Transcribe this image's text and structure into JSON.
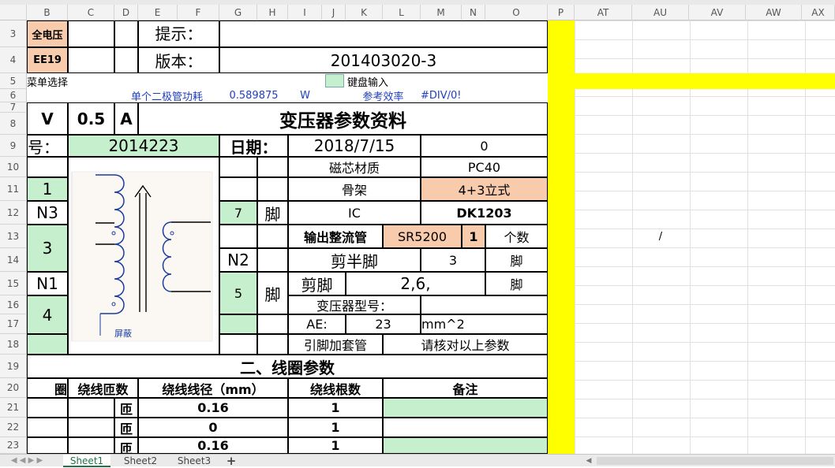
{
  "columns": [
    "B",
    "C",
    "D",
    "E",
    "F",
    "G",
    "H",
    "I",
    "J",
    "K",
    "L",
    "M",
    "N",
    "O",
    "P",
    "AT",
    "AU",
    "AV",
    "AW",
    "AX"
  ],
  "rows": [
    "3",
    "4",
    "5",
    "6",
    "7",
    "8",
    "9",
    "10",
    "11",
    "12",
    "13",
    "14",
    "15",
    "16",
    "17",
    "18",
    "19",
    "20",
    "21",
    "22",
    "23"
  ],
  "c": {
    "r3b": "全电压",
    "r3e": "提示：",
    "r4b": "EE19",
    "r4e": "版本：",
    "r4k": "201403020-3",
    "r5b": "菜单选择",
    "r5k": "键盘输入",
    "r6d": "单个二极管功耗",
    "r6g": "0.589875",
    "r6i": "W",
    "r6l": "参考效率",
    "r6m": "#DIV/0!",
    "r7b": "V",
    "r7c": "0.5",
    "r7d": "A",
    "r7h": "变压器参数资料",
    "r9b": "号：",
    "r9c": "2014223",
    "r9g": "日期：",
    "r9j": "2018/7/15",
    "r9n": "0",
    "r10i": "磁芯材质",
    "r10m": "PC40",
    "r11b": "1",
    "r11i": "骨架",
    "r11m": "4+3立式",
    "r12b": "N3",
    "r12g": "7",
    "r12h": "脚",
    "r12i": "IC",
    "r12m": "DK1203",
    "r13i": "输出整流管",
    "r13l": "SR5200",
    "r13n": "1",
    "r13o": "个数",
    "r14b": "3",
    "r14g": "N2",
    "r14i": "剪半脚",
    "r14m": "3",
    "r14o": "脚",
    "r15b": "N1",
    "r15g": "5",
    "r15h": "脚",
    "r15i": "剪脚",
    "r15k": "2,6,",
    "r15o": "脚",
    "r16i": "变压器型号：",
    "r17b": "4",
    "r17i": "AE:",
    "r17k": "23",
    "r17l": "mm^2",
    "r18i": "引脚加套管",
    "r18l": "请核对以上参数",
    "r19": "二、线圈参数",
    "r20b": "圈",
    "r20c": "绕线匝数",
    "r20e": "绕线线径（mm）",
    "r20j": "绕线根数",
    "r20l": "备注",
    "r21d": "匝",
    "r21e": "0.16",
    "r21j": "1",
    "r22d": "匝",
    "r22e": "0",
    "r22j": "1",
    "r23d": "匝",
    "r23e": "0.16",
    "r23j": "1",
    "slash": "/",
    "shield": "屏蔽"
  },
  "sheets": [
    "Sheet1",
    "Sheet2",
    "Sheet3"
  ],
  "colors": {
    "green": "#c6efce",
    "orange": "#f8cbad",
    "yellow": "#ffff00",
    "sheetActive": "#217346"
  }
}
